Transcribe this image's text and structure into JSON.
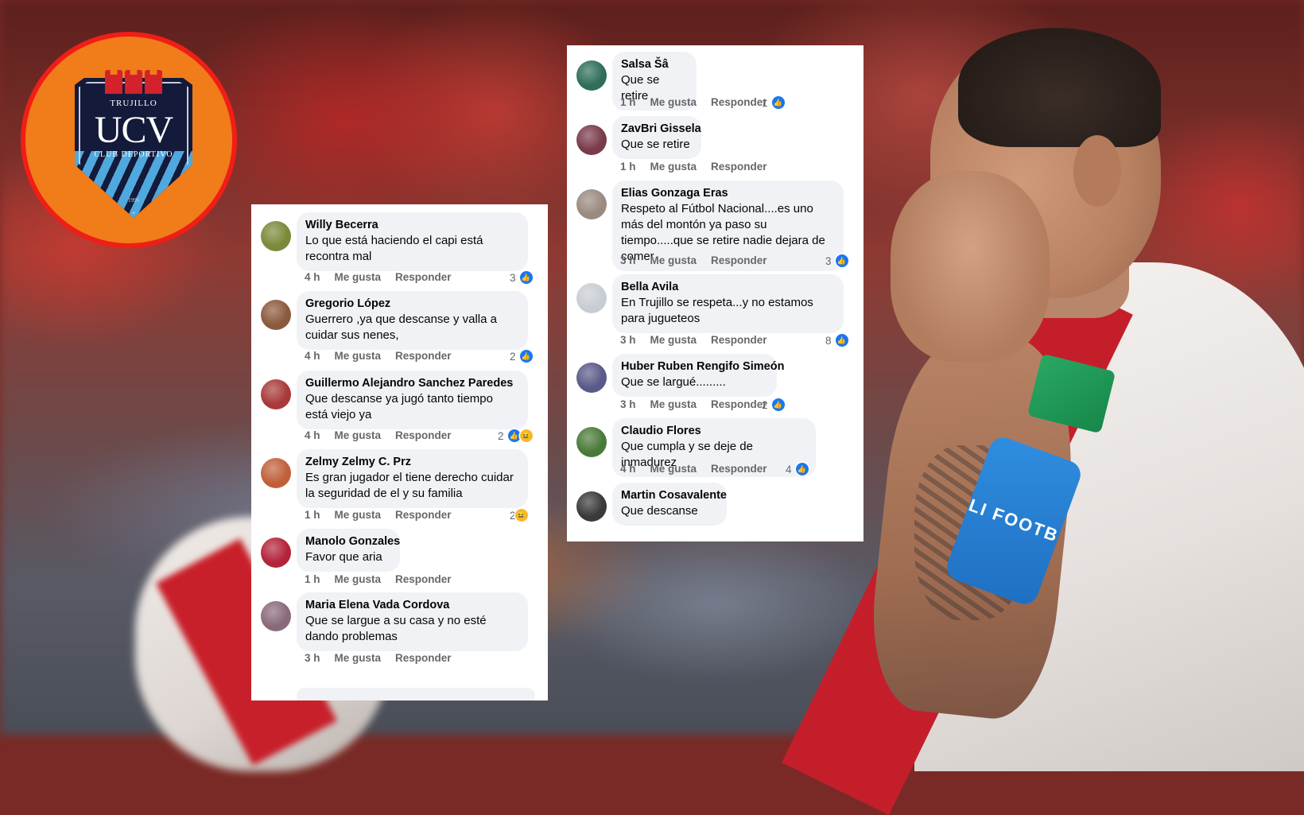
{
  "logo": {
    "top_text": "TRUJILLO",
    "initials": "UCV",
    "bottom_text": "CLUB DEPORTIVO",
    "year": "1996",
    "colors": {
      "circle": "#f07c1a",
      "ring": "#f01e17",
      "shield": "#131a3a",
      "stripes": "#4fa8de",
      "towers": "#d3222b"
    }
  },
  "armband_text": "LI FOOTB",
  "like_glyph": "👍",
  "haha_glyph": "😆",
  "left_comments": [
    {
      "name": "Willy Becerra",
      "text": "Lo que está haciendo el capi está recontra mal",
      "time": "4 h",
      "like": "Me gusta",
      "reply": "Responder",
      "count": "3",
      "reactions": [
        "like"
      ],
      "avatar_color": "#7a8a3a"
    },
    {
      "name": "Gregorio López",
      "text": "Guerrero ,ya que descanse y valla a cuidar sus nenes,",
      "time": "4 h",
      "like": "Me gusta",
      "reply": "Responder",
      "count": "2",
      "reactions": [
        "like"
      ],
      "avatar_color": "#8b5a3c"
    },
    {
      "name": "Guillermo Alejandro Sanchez Paredes",
      "text": "Que descanse ya jugó tanto tiempo está viejo ya",
      "time": "4 h",
      "like": "Me gusta",
      "reply": "Responder",
      "count": "2",
      "reactions": [
        "like",
        "haha"
      ],
      "avatar_color": "#a83a3a"
    },
    {
      "name": "Zelmy Zelmy C. Prz",
      "text": "Es gran jugador el tiene derecho cuidar la seguridad de el y su familia",
      "time": "1 h",
      "like": "Me gusta",
      "reply": "Responder",
      "count": "2",
      "reactions": [
        "haha"
      ],
      "avatar_color": "#c0603a"
    },
    {
      "name": "Manolo Gonzales",
      "text": "Favor que aria",
      "time": "1 h",
      "like": "Me gusta",
      "reply": "Responder",
      "count": "",
      "reactions": [],
      "avatar_color": "#b3243a"
    },
    {
      "name": "Maria Elena Vada Cordova",
      "text": "Que se largue a su casa y no esté dando problemas",
      "time": "3 h",
      "like": "Me gusta",
      "reply": "Responder",
      "count": "",
      "reactions": [],
      "avatar_color": "#8a6a7a"
    }
  ],
  "right_comments": [
    {
      "name": "Salsa Šâ",
      "text": "Que se retire",
      "time": "1 h",
      "like": "Me gusta",
      "reply": "Responder",
      "count": "1",
      "reactions": [
        "like"
      ],
      "avatar_color": "#2e6e5a"
    },
    {
      "name": "ZavBri Gissela",
      "text": "Que se retire",
      "time": "1 h",
      "like": "Me gusta",
      "reply": "Responder",
      "count": "",
      "reactions": [],
      "avatar_color": "#7a3a4a"
    },
    {
      "name": "Elias Gonzaga Eras",
      "text": "Respeto al Fútbol Nacional....es uno más del montón ya paso su tiempo.....que se retire nadie dejara de comer",
      "time": "3 h",
      "like": "Me gusta",
      "reply": "Responder",
      "count": "3",
      "reactions": [
        "like"
      ],
      "avatar_color": "#9a8a80"
    },
    {
      "name": "Bella Avila",
      "text": "En Trujillo se respeta...y no estamos para jugueteos",
      "time": "3 h",
      "like": "Me gusta",
      "reply": "Responder",
      "count": "8",
      "reactions": [
        "like"
      ],
      "avatar_color": "#c8cdd4"
    },
    {
      "name": "Huber Ruben Rengifo Simeón",
      "text": "Que se largué.........",
      "time": "3 h",
      "like": "Me gusta",
      "reply": "Responder",
      "count": "2",
      "reactions": [
        "like"
      ],
      "avatar_color": "#5a5a8a"
    },
    {
      "name": "Claudio Flores",
      "text": "Que cumpla y se deje de inmadurez",
      "time": "4 h",
      "like": "Me gusta",
      "reply": "Responder",
      "count": "4",
      "reactions": [
        "like"
      ],
      "avatar_color": "#4a7a3a"
    },
    {
      "name": "Martin Cosavalente",
      "text": "Que descanse",
      "time": "",
      "like": "",
      "reply": "",
      "count": "",
      "reactions": [],
      "avatar_color": "#3a3a3a"
    }
  ]
}
